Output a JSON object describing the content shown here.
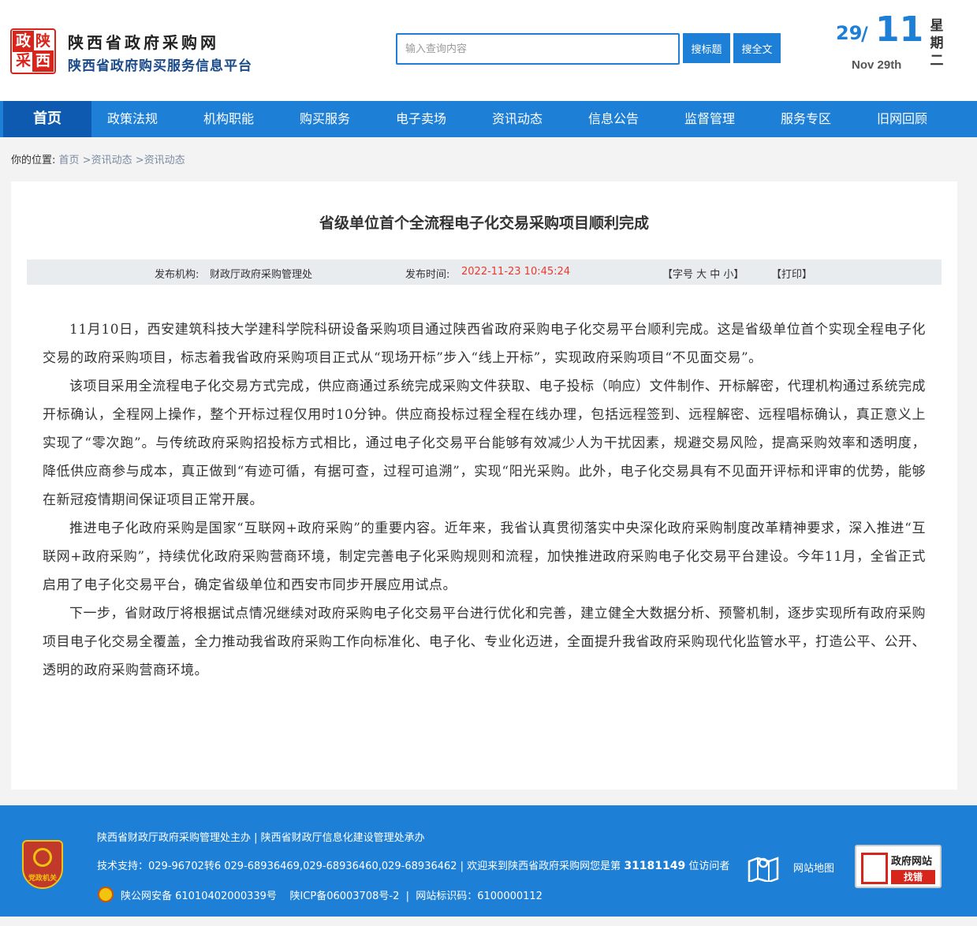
{
  "header": {
    "logo_chars": [
      "政",
      "陕",
      "采",
      "西"
    ],
    "title": "陕西省政府采购网",
    "subtitle": "陕西省政府购买服务信息平台",
    "search_placeholder": "输入查询内容",
    "btn_search_title": "搜标题",
    "btn_search_full": "搜全文",
    "date_day": "29",
    "date_slash": "/",
    "date_month": "11",
    "date_en": "Nov 29th",
    "weekday": [
      "星",
      "期",
      "二"
    ]
  },
  "nav": {
    "items": [
      "首页",
      "政策法规",
      "机构职能",
      "购买服务",
      "电子卖场",
      "资讯动态",
      "信息公告",
      "监督管理",
      "服务专区",
      "旧网回顾"
    ]
  },
  "breadcrumb": {
    "prefix": "你的位置:",
    "home": "首页",
    "sep1": " >资讯动态",
    "sep2": " >资讯动态"
  },
  "article": {
    "title": "省级单位首个全流程电子化交易采购项目顺利完成",
    "publisher_label": "发布机构:",
    "publisher": "财政厅政府采购管理处",
    "time_label": "发布时间:",
    "time": "2022-11-23 10:45:24",
    "font_size_ctrl": "【字号 大 中 小】",
    "print": "【打印】",
    "paragraphs": [
      "11月10日，西安建筑科技大学建科学院科研设备采购项目通过陕西省政府采购电子化交易平台顺利完成。这是省级单位首个实现全程电子化交易的政府采购项目，标志着我省政府采购项目正式从“现场开标”步入“线上开标”，实现政府采购项目“不见面交易”。",
      "该项目采用全流程电子化交易方式完成，供应商通过系统完成采购文件获取、电子投标（响应）文件制作、开标解密，代理机构通过系统完成开标确认，全程网上操作，整个开标过程仅用时10分钟。供应商投标过程全程在线办理，包括远程签到、远程解密、远程唱标确认，真正意义上实现了“零次跑”。与传统政府采购招投标方式相比，通过电子化交易平台能够有效减少人为干扰因素，规避交易风险，提高采购效率和透明度，降低供应商参与成本，真正做到“有迹可循，有据可查，过程可追溯”，实现“阳光采购。此外，电子化交易具有不见面开评标和评审的优势，能够在新冠疫情期间保证项目正常开展。",
      "推进电子化政府采购是国家“互联网+政府采购”的重要内容。近年来，我省认真贯彻落实中央深化政府采购制度改革精神要求，深入推进“互联网+政府采购”，持续优化政府采购营商环境，制定完善电子化采购规则和流程，加快推进政府采购电子化交易平台建设。今年11月，全省正式启用了电子化交易平台，确定省级单位和西安市同步开展应用试点。",
      "下一步，省财政厅将根据试点情况继续对政府采购电子化交易平台进行优化和完善，建立健全大数据分析、预警机制，逐步实现所有政府采购项目电子化交易全覆盖，全力推动我省政府采购工作向标准化、电子化、专业化迈进，全面提升我省政府采购现代化监管水平，打造公平、公开、透明的政府采购营商环境。"
    ]
  },
  "footer": {
    "emblem_text": "党政机关",
    "line1": "陕西省财政厅政府采购管理处主办 | 陕西省财政厅信息化建设管理处承办",
    "line2_prefix": "技术支持：029-96702转6 029-68936469,029-68936460,029-68936462 | 欢迎来到陕西省政府采购网您是第 ",
    "visitor_count": "31181149",
    "line2_suffix": " 位访问者",
    "line3": "陕公网安备 61010402000339号    陕ICP备06003708号-2  |  网站标识码：6100000112",
    "site_map": "网站地图",
    "gov_badge_top": "政府网站",
    "gov_badge_bottom": "找错"
  }
}
